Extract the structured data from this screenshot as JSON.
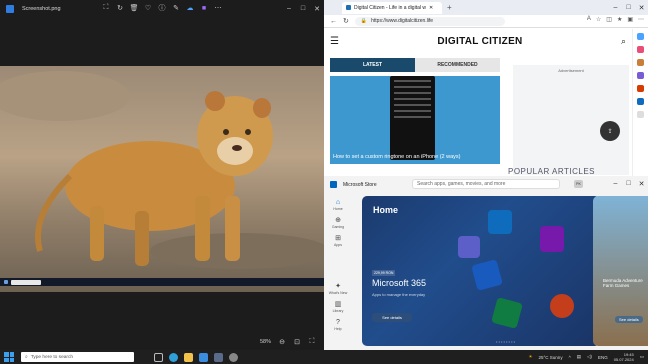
{
  "photos": {
    "filename": "Screenshot.png",
    "zoom": "58%",
    "toolbar_icons": [
      "crop-icon",
      "rotate-icon",
      "delete-icon",
      "heart-icon",
      "info-icon",
      "edit-icon",
      "cloud-icon",
      "copilot-icon",
      "more-icon"
    ]
  },
  "edge": {
    "tab_title": "Digital Citizen - Life in a digital w",
    "url": "https://www.digitalcitizen.life",
    "site": {
      "logo": "DIGITAL CITIZEN",
      "tab_latest": "LATEST",
      "tab_recommended": "RECOMMENDED",
      "article_title": "How to set a custom ringtone on an iPhone (2 ways)",
      "ad_label": "Advertisement",
      "popular": "POPULAR ARTICLES"
    }
  },
  "store": {
    "app_name": "Microsoft Store",
    "search_placeholder": "Search apps, games, movies, and more",
    "avatar": "PK",
    "nav": [
      {
        "label": "Home"
      },
      {
        "label": "Gaming"
      },
      {
        "label": "Apps"
      },
      {
        "label": "What's New"
      },
      {
        "label": "Library"
      },
      {
        "label": "Help"
      }
    ],
    "hero_title": "Home",
    "price": "229,99 RON",
    "product_name": "Microsoft 365",
    "product_sub": "Apps to manage the everyday",
    "see_details": "See details",
    "side_name": "Bermuda Adventure Farm Games",
    "side_see": "See details"
  },
  "taskbar": {
    "search_placeholder": "Type here to search",
    "weather": "25°C  Sunny",
    "lang": "ENG",
    "time": "19:45",
    "date": "05.07.2024"
  },
  "colors": {
    "latest_tab": "#1a4a6b",
    "article_bg": "#3d98cf",
    "store_hero": "#214d8c",
    "taskbar": "#1f1f1f"
  }
}
